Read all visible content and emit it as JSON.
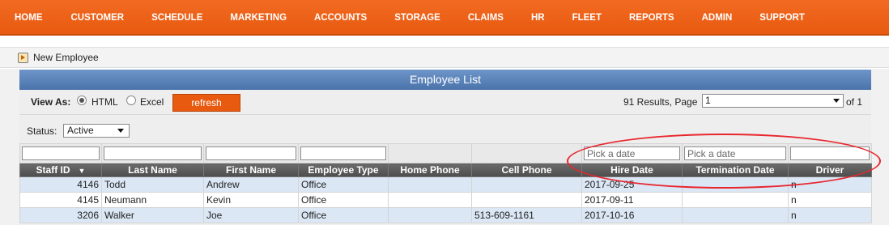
{
  "nav": {
    "items": [
      "HOME",
      "CUSTOMER",
      "SCHEDULE",
      "MARKETING",
      "ACCOUNTS",
      "STORAGE",
      "CLAIMS",
      "HR",
      "FLEET",
      "REPORTS",
      "ADMIN",
      "SUPPORT"
    ]
  },
  "subbar": {
    "new_employee": "New Employee"
  },
  "panel": {
    "title": "Employee List",
    "view_as_label": "View As:",
    "view_html": "HTML",
    "view_excel": "Excel",
    "refresh": "refresh",
    "results_text": "91 Results, Page",
    "page_value": "1",
    "of_text": "of 1",
    "status_label": "Status:",
    "status_value": "Active"
  },
  "filters": {
    "hire_placeholder": "Pick a date",
    "term_placeholder": "Pick a date"
  },
  "table": {
    "columns": [
      "Staff ID",
      "Last Name",
      "First Name",
      "Employee Type",
      "Home Phone",
      "Cell Phone",
      "Hire Date",
      "Termination Date",
      "Driver"
    ],
    "sort_glyph": "▼",
    "rows": [
      [
        "4146",
        "Todd",
        "Andrew",
        "Office",
        "",
        "",
        "2017-09-25",
        "",
        "n"
      ],
      [
        "4145",
        "Neumann",
        "Kevin",
        "Office",
        "",
        "",
        "2017-09-11",
        "",
        "n"
      ],
      [
        "3206",
        "Walker",
        "Joe",
        "Office",
        "",
        "513-609-1161",
        "2017-10-16",
        "",
        "n"
      ]
    ]
  },
  "colors": {
    "nav_orange": "#e85a10",
    "title_blue": "#4a73ab",
    "header_gray": "#555555",
    "row_blue": "#dbe7f5",
    "annotation_red": "#e8262e"
  }
}
